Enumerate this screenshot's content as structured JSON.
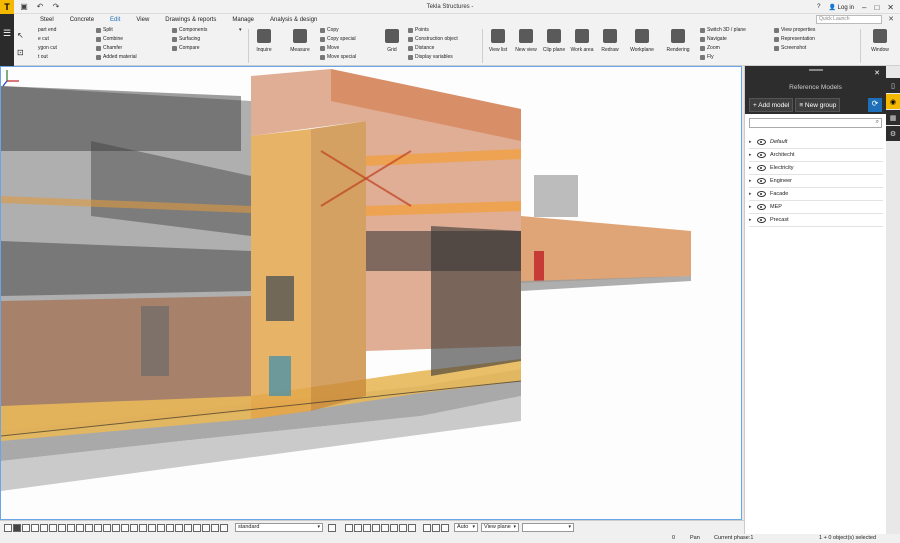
{
  "app": {
    "title": "Tekla Structures -",
    "logo": "T",
    "login": "Log in",
    "help": "?",
    "quick_launch_placeholder": "Quick Launch"
  },
  "menu": {
    "tabs": [
      "Steel",
      "Concrete",
      "Edit",
      "View",
      "Drawings & reports",
      "Manage",
      "Analysis & design"
    ],
    "active_tab": "Edit"
  },
  "ribbon": {
    "col1": [
      "part end",
      "e cut",
      "ygon cut",
      "t out"
    ],
    "col2": [
      "Split",
      "Combine",
      "Chamfer",
      "Added material"
    ],
    "col3": [
      "Components",
      "Surfacing",
      "Compare"
    ],
    "col4": [
      "Copy",
      "Copy special",
      "Move",
      "Move special"
    ],
    "col5": [
      "Points",
      "Construction object",
      "Distance",
      "Display variables"
    ],
    "col6": [
      "Switch 3D / plane",
      "Navigate",
      "Zoom",
      "Fly"
    ],
    "col7": [
      "View properties",
      "Representation",
      "Screenshot"
    ],
    "big_buttons": {
      "inquire": "Inquire",
      "measure": "Measure",
      "grid": "Grid",
      "view_list": "View list",
      "new_view": "New view",
      "clip_plane": "Clip plane",
      "work_area": "Work area",
      "redraw": "Redraw",
      "workplane": "Workplane",
      "rendering": "Rendering",
      "window": "Window"
    }
  },
  "panel": {
    "title": "Reference Models",
    "add_model": "+ Add model",
    "new_group": "≡ New group",
    "search_placeholder": "",
    "models": [
      {
        "name": "Default",
        "italic": true
      },
      {
        "name": "Architecht",
        "italic": false
      },
      {
        "name": "Electricity",
        "italic": false
      },
      {
        "name": "Engineer",
        "italic": false
      },
      {
        "name": "Facade",
        "italic": false
      },
      {
        "name": "MEP",
        "italic": false
      },
      {
        "name": "Precast",
        "italic": false
      }
    ]
  },
  "bottombar": {
    "filter_value": "standard",
    "snap_value": "Auto",
    "plane_value": "View plane"
  },
  "status": {
    "zero": "0",
    "pan": "Pan",
    "phase": "Current phase:1",
    "selection": "1 + 0 object(s) selected"
  },
  "colors": {
    "accent": "#f5b800",
    "selection_blue": "#1f6fb8",
    "panel_dark": "#2d2d2d"
  }
}
